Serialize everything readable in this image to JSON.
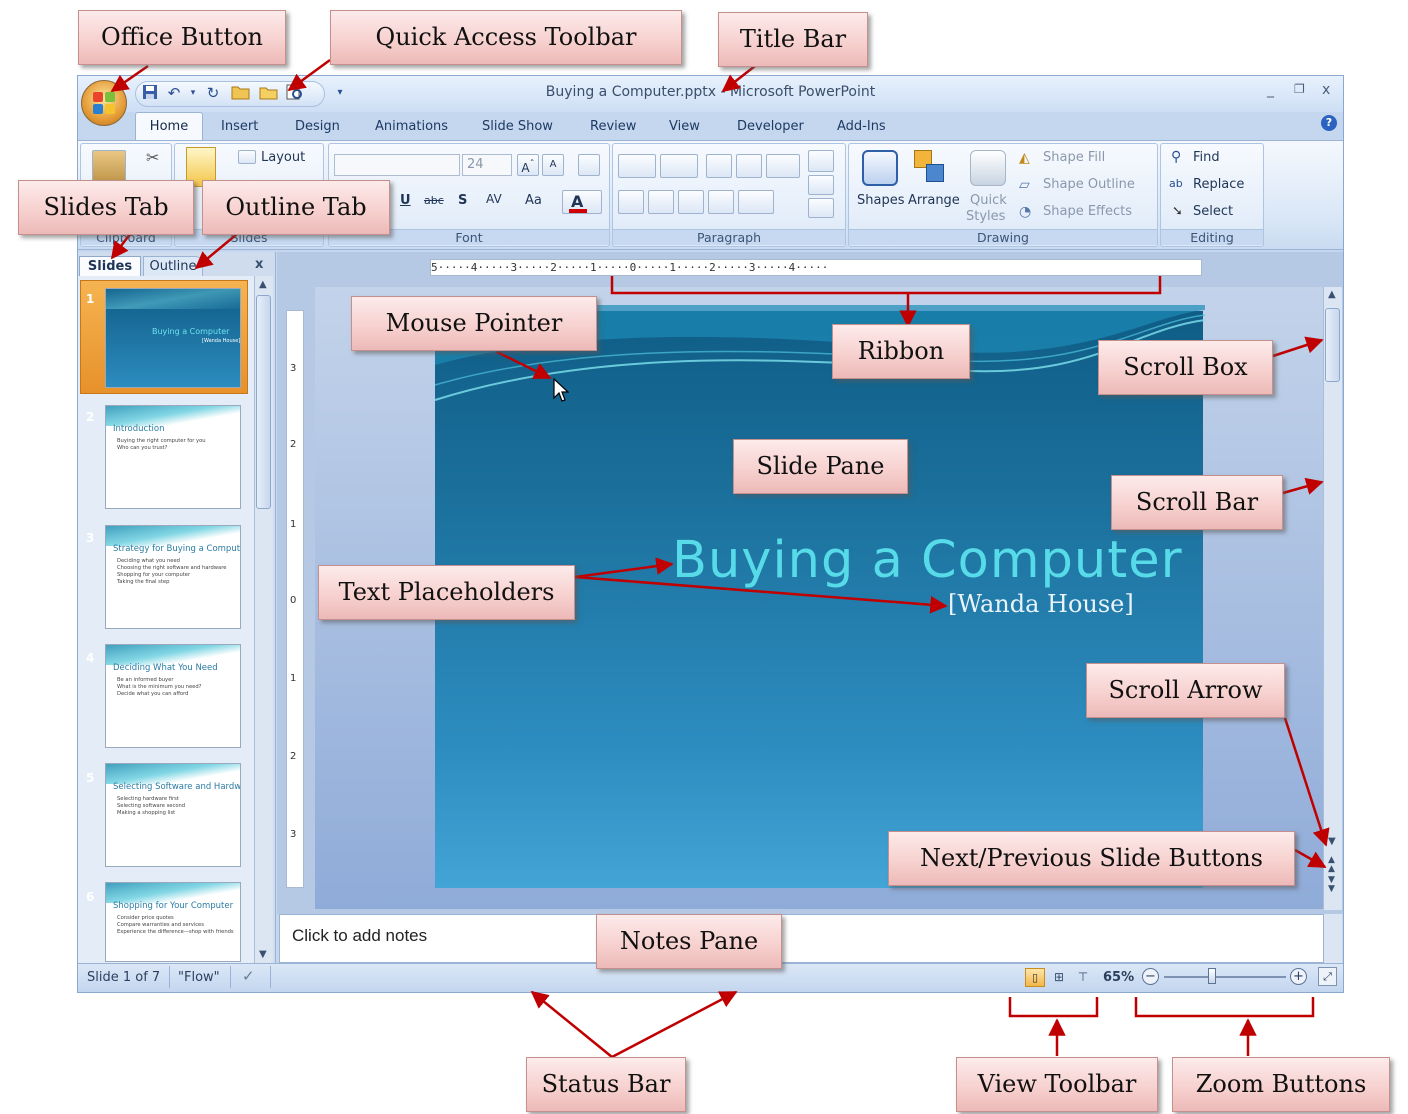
{
  "window": {
    "title": "Buying a Computer.pptx - Microsoft PowerPoint",
    "controls": {
      "minimize": "_",
      "restore": "❐",
      "close": "x"
    }
  },
  "ribbon": {
    "tabs": [
      "Home",
      "Insert",
      "Design",
      "Animations",
      "Slide Show",
      "Review",
      "View",
      "Developer",
      "Add-Ins"
    ],
    "active_tab": "Home",
    "groups": {
      "clipboard": "Clipboard",
      "slides": "Slides",
      "font": "Font",
      "paragraph": "Paragraph",
      "drawing": "Drawing",
      "editing": "Editing"
    },
    "layout_label": "Layout",
    "font_size": "24",
    "shapes_label": "Shapes",
    "arrange_label": "Arrange",
    "quick_styles_label1": "Quick",
    "quick_styles_label2": "Styles",
    "shape_fill": "Shape Fill",
    "shape_outline": "Shape Outline",
    "shape_effects": "Shape Effects",
    "find": "Find",
    "replace": "Replace",
    "select": "Select"
  },
  "left_pane": {
    "tab_slides": "Slides",
    "tab_outline": "Outline",
    "close": "x",
    "thumbnails": [
      {
        "num": "1",
        "title": "Buying a Computer",
        "sub": "[Wanda House]"
      },
      {
        "num": "2",
        "title": "Introduction",
        "bullets": [
          "Buying the right computer for you",
          "Who can you trust?"
        ]
      },
      {
        "num": "3",
        "title": "Strategy for Buying a Computer",
        "bullets": [
          "Deciding what you need",
          "Choosing the right software and hardware",
          "Shopping for your computer",
          "Taking the final step"
        ]
      },
      {
        "num": "4",
        "title": "Deciding What You Need",
        "bullets": [
          "Be an informed buyer",
          "What is the minimum you need?",
          "Decide what you can afford"
        ]
      },
      {
        "num": "5",
        "title": "Selecting Software and Hardware",
        "bullets": [
          "Selecting hardware first",
          "Selecting software second",
          "Making a shopping list"
        ]
      },
      {
        "num": "6",
        "title": "Shopping for Your Computer",
        "bullets": [
          "Consider price quotes",
          "Compare warranties and services",
          "Experience the difference—shop with friends"
        ]
      }
    ]
  },
  "ruler": {
    "horizontal": "5·····4·····3·····2·····1·····0·····1·····2·····3·····4·····",
    "vertical": [
      "3",
      "2",
      "1",
      "0",
      "1",
      "2",
      "3"
    ]
  },
  "slide": {
    "title": "Buying a Computer",
    "subtitle": "[Wanda House]"
  },
  "notes": {
    "placeholder": "Click to add notes"
  },
  "status_bar": {
    "slide_info": "Slide 1 of 7",
    "theme": "\"Flow\"",
    "zoom": "65%"
  },
  "callouts": {
    "office_button": "Office Button",
    "quick_access_toolbar": "Quick Access Toolbar",
    "title_bar": "Title Bar",
    "slides_tab": "Slides Tab",
    "outline_tab": "Outline Tab",
    "mouse_pointer": "Mouse Pointer",
    "ribbon": "Ribbon",
    "scroll_box": "Scroll Box",
    "slide_pane": "Slide Pane",
    "scroll_bar": "Scroll Bar",
    "text_placeholders": "Text Placeholders",
    "scroll_arrow": "Scroll Arrow",
    "next_prev_buttons": "Next/Previous Slide Buttons",
    "notes_pane": "Notes Pane",
    "status_bar": "Status Bar",
    "view_toolbar": "View Toolbar",
    "zoom_buttons": "Zoom Buttons"
  },
  "colors": {
    "callout_fill": "#f6cfcd",
    "arrow": "#c00000",
    "slide_title": "#57dbe8",
    "ribbon_bg": "#dae7f7"
  }
}
